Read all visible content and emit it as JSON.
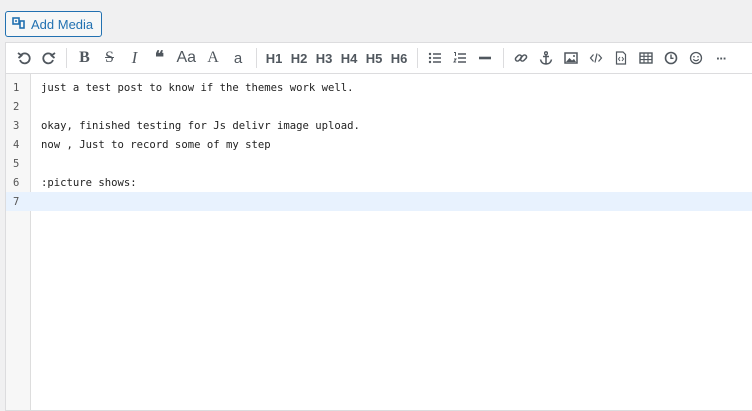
{
  "add_media": {
    "label": "Add Media"
  },
  "toolbar": {
    "undo": "undo-icon",
    "redo": "redo-icon",
    "bold": "B",
    "strike": "S",
    "italic": "I",
    "quote": "❝",
    "case": "Aa",
    "upper": "A",
    "lower": "a",
    "h1": "H1",
    "h2": "H2",
    "h3": "H3",
    "h4": "H4",
    "h5": "H5",
    "h6": "H6",
    "more": "···"
  },
  "editor": {
    "lines": [
      {
        "num": "1",
        "text": "just a test post to know if the themes work well."
      },
      {
        "num": "2",
        "text": ""
      },
      {
        "num": "3",
        "text": "okay, finished testing for Js delivr image upload."
      },
      {
        "num": "4",
        "text": "now , Just to record some of my step"
      },
      {
        "num": "5",
        "text": ""
      },
      {
        "num": "6",
        "text": ":picture shows:"
      },
      {
        "num": "7",
        "text": ""
      }
    ],
    "active_line": 7
  },
  "colors": {
    "accent": "#2271b1",
    "icon": "#50575e",
    "active_line_bg": "#e8f2fe"
  }
}
